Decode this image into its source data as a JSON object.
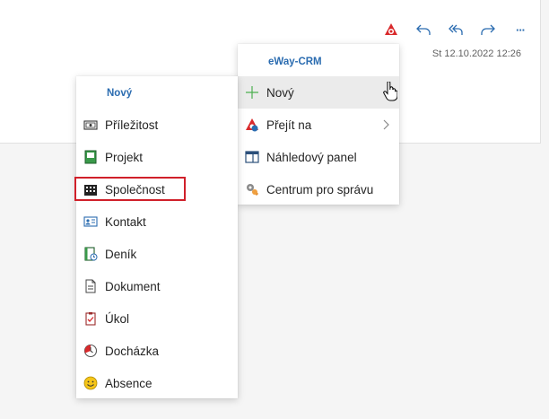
{
  "mail": {
    "date": "St 12.10.2022 12:26"
  },
  "toolbar": {
    "icons": [
      "eway-logo-icon",
      "reply-icon",
      "reply-all-icon",
      "forward-icon",
      "more-icon"
    ],
    "more_label": "···"
  },
  "eway_menu": {
    "header": "eWay-CRM",
    "items": [
      {
        "label": "Nový",
        "icon": "plus-icon"
      },
      {
        "label": "Přejít na",
        "icon": "eway-goto-icon"
      },
      {
        "label": "Náhledový panel",
        "icon": "preview-panel-icon"
      },
      {
        "label": "Centrum pro správu",
        "icon": "admin-center-icon"
      }
    ]
  },
  "new_menu": {
    "header": "Nový",
    "items": [
      {
        "label": "Příležitost",
        "icon": "opportunity-icon"
      },
      {
        "label": "Projekt",
        "icon": "project-icon"
      },
      {
        "label": "Společnost",
        "icon": "company-icon"
      },
      {
        "label": "Kontakt",
        "icon": "contact-icon"
      },
      {
        "label": "Deník",
        "icon": "journal-icon"
      },
      {
        "label": "Dokument",
        "icon": "document-icon"
      },
      {
        "label": "Úkol",
        "icon": "task-icon"
      },
      {
        "label": "Docházka",
        "icon": "attendance-icon"
      },
      {
        "label": "Absence",
        "icon": "absence-icon"
      }
    ]
  },
  "colors": {
    "accent": "#2b6cb0",
    "highlight": "#d0202a",
    "eway_red": "#d9292b"
  }
}
